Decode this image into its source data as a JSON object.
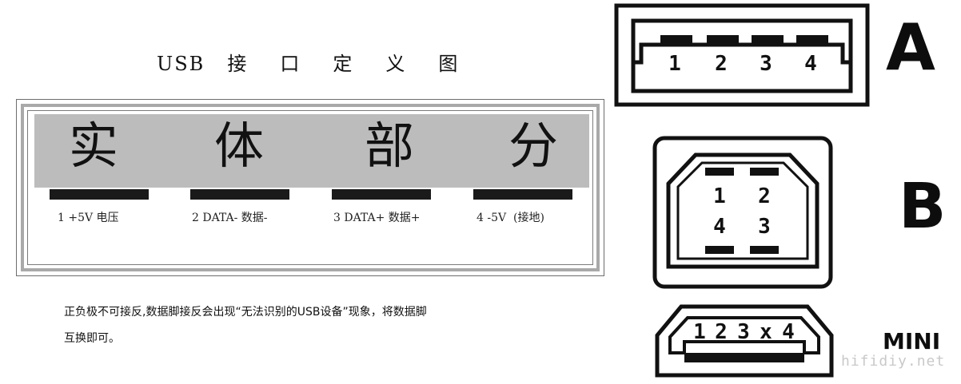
{
  "title": {
    "parts": [
      "USB",
      "接",
      "口",
      "定",
      "义",
      "图"
    ]
  },
  "body_parts": {
    "chars": [
      "实",
      "体",
      "部",
      "分"
    ]
  },
  "pins": [
    {
      "label": "1 +5V 电压"
    },
    {
      "label": "2 DATA- 数据-"
    },
    {
      "label": "3 DATA+ 数据+"
    },
    {
      "label": "4 -5V  (接地)"
    }
  ],
  "note": {
    "line1": "正负极不可接反,数据脚接反会出现“无法识别的USB设备”现象，将数据脚",
    "line2": "互换即可。"
  },
  "connectors": {
    "a": {
      "label": "A",
      "pins": [
        "1",
        "2",
        "3",
        "4"
      ]
    },
    "b": {
      "label": "B",
      "pins": [
        "1",
        "2",
        "4",
        "3"
      ]
    },
    "mini": {
      "label": "MINI",
      "pins": [
        "1",
        "2",
        "3",
        "x",
        "4"
      ]
    }
  },
  "watermark": "hifidiy.net"
}
